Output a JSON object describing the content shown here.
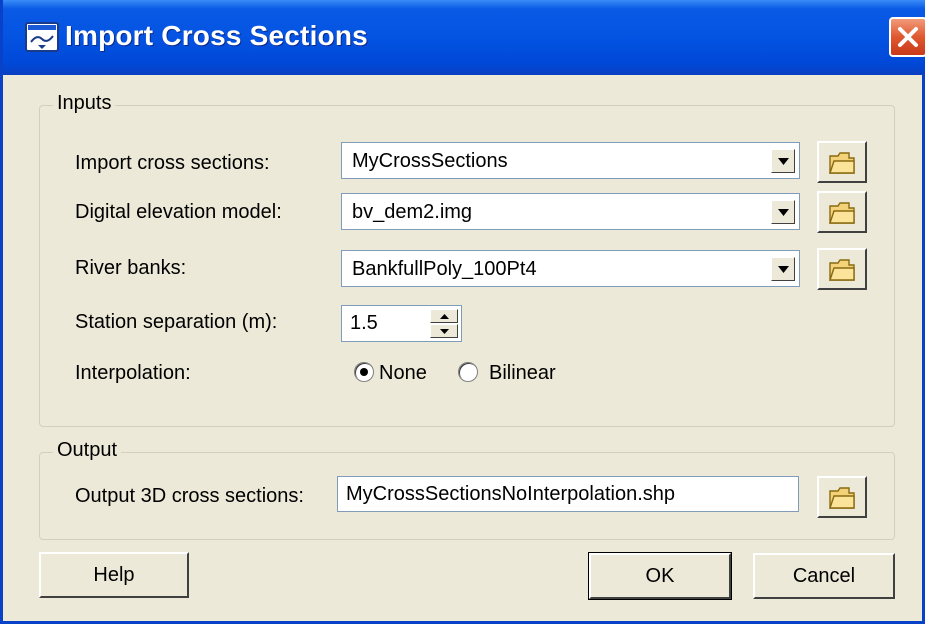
{
  "window": {
    "title": "Import Cross Sections"
  },
  "inputs": {
    "legend": "Inputs",
    "import_cross_sections": {
      "label": "Import cross sections:",
      "value": "MyCrossSections"
    },
    "dem": {
      "label": "Digital elevation model:",
      "value": "bv_dem2.img"
    },
    "river_banks": {
      "label": "River banks:",
      "value": "BankfullPoly_100Pt4"
    },
    "station_separation": {
      "label": "Station separation (m):",
      "value": "1.5"
    },
    "interpolation": {
      "label": "Interpolation:",
      "options": [
        {
          "label": "None",
          "selected": true
        },
        {
          "label": "Bilinear",
          "selected": false
        }
      ]
    }
  },
  "output": {
    "legend": "Output",
    "output_3d": {
      "label": "Output 3D cross sections:",
      "value": "MyCrossSectionsNoInterpolation.shp"
    }
  },
  "buttons": {
    "help": "Help",
    "ok": "OK",
    "cancel": "Cancel"
  },
  "icons": {
    "title": "dialog-app-icon",
    "close": "close-icon",
    "browse": "folder-icon",
    "dropdown": "chevron-down-icon"
  },
  "colors": {
    "titlebar": "#0453e2",
    "close_button": "#e0582f",
    "dialog_bg": "#ece9d8",
    "folder": "#f3d27a"
  }
}
